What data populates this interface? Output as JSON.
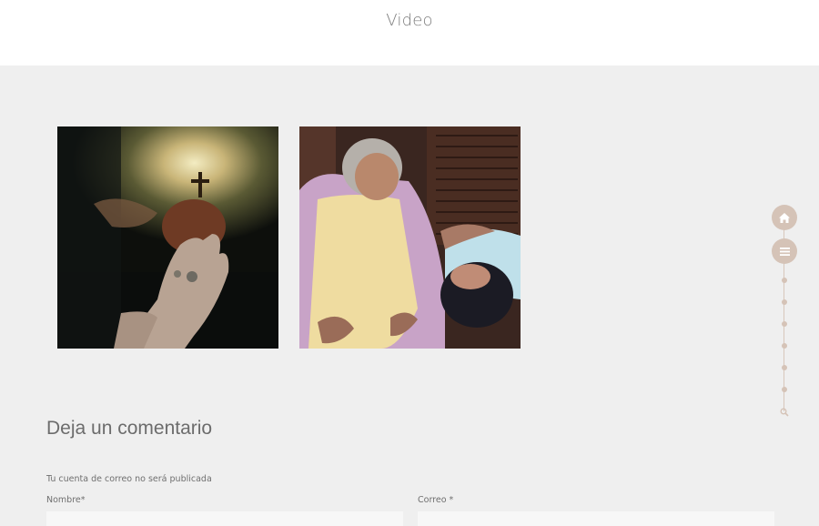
{
  "header": {
    "title": "Video"
  },
  "gallery": {
    "items": [
      {
        "name": "Fotograma del video: mano con anillos frente a un corazón sagrado"
      },
      {
        "name": "Fotograma del video: mujer mayor junto a una joven recostada"
      }
    ]
  },
  "side_nav": {
    "icons": [
      "home-icon",
      "menu-icon",
      "search-icon"
    ],
    "dot_count": 6
  },
  "comments": {
    "title": "Deja un comentario",
    "notice": "Tu cuenta de correo no será publicada",
    "name_label": "Nombre*",
    "email_label": "Correo *",
    "name_value": "",
    "email_value": ""
  },
  "colors": {
    "background": "#efefef",
    "header_bg": "#ffffff",
    "accent": "#d5c3b7"
  }
}
